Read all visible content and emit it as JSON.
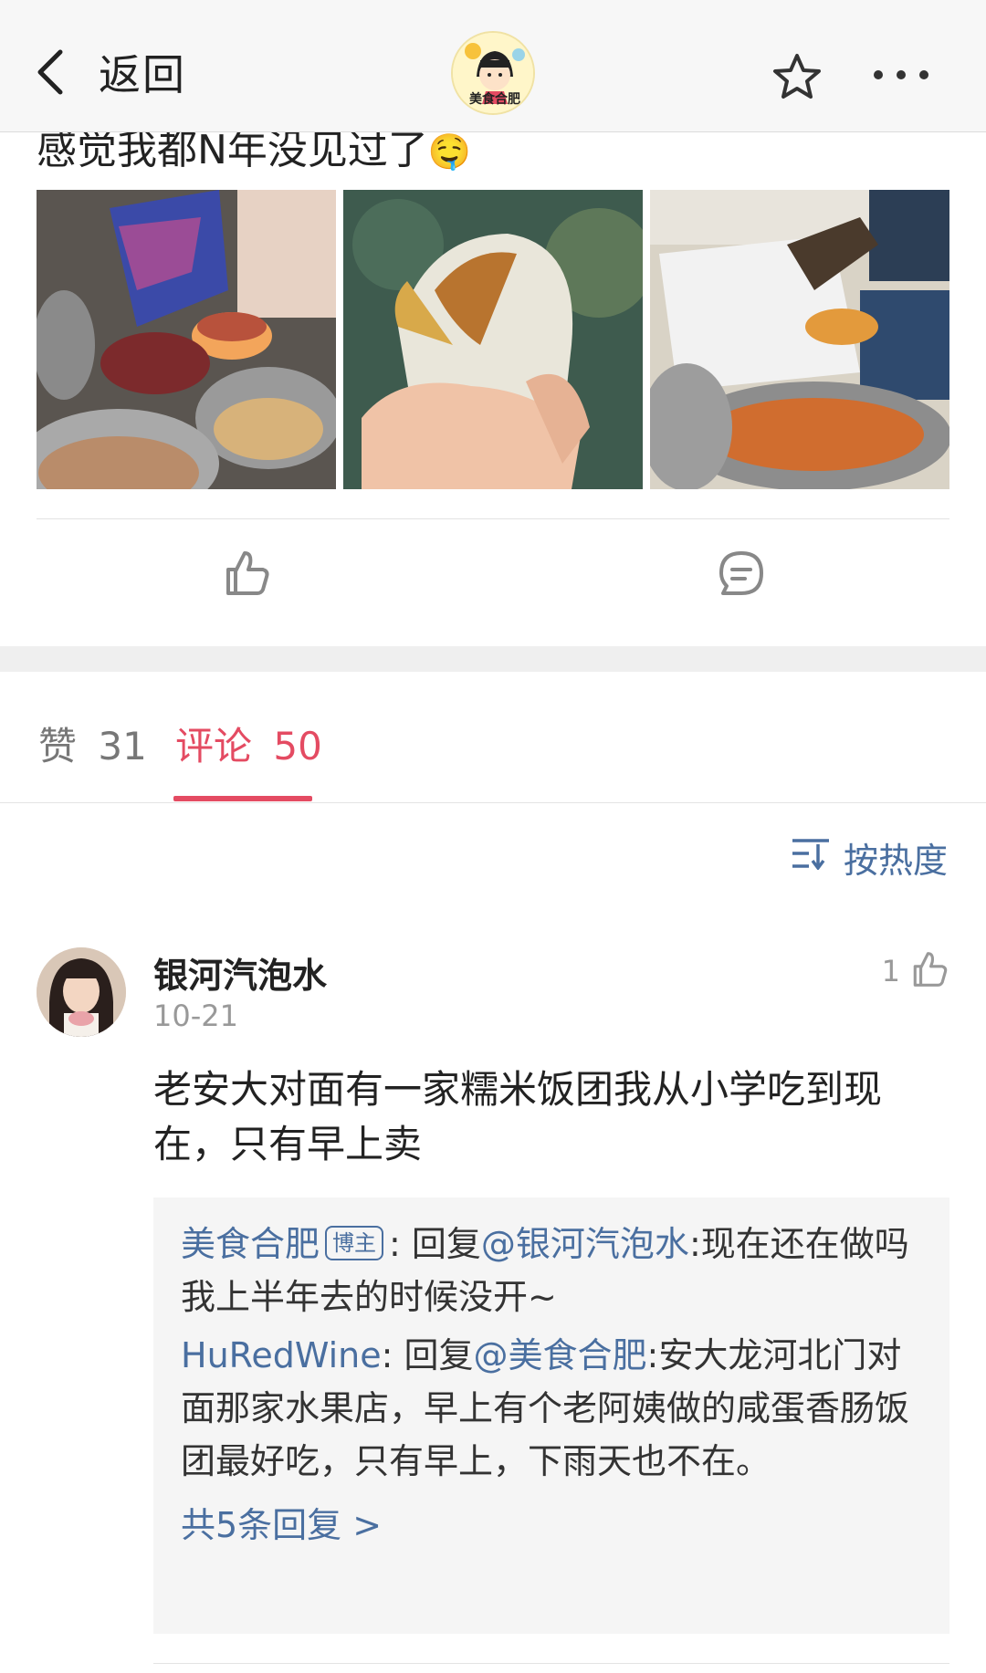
{
  "header": {
    "back_label": "返回",
    "avatar_text": "美食合肥"
  },
  "post": {
    "text": "感觉我都N年没见过了",
    "emoji": "🤤",
    "images": [
      "rice-ball-making",
      "rice-ball-in-hand",
      "rice-ball-vendor"
    ]
  },
  "tabs": {
    "likes_label": "赞",
    "likes_count": "31",
    "comments_label": "评论",
    "comments_count": "50"
  },
  "sort": {
    "label": "按热度"
  },
  "comment": {
    "author": "银河汽泡水",
    "date": "10-21",
    "likes": "1",
    "text": "老安大对面有一家糯米饭团我从小学吃到现在，只有早上卖",
    "replies": [
      {
        "author": "美食合肥",
        "badge": "博主",
        "sep": ": ",
        "verb": "回复",
        "mention": "@银河汽泡水",
        "text": ":现在还在做吗 我上半年去的时候没开~"
      },
      {
        "author": "HuRedWine",
        "sep": ": ",
        "verb": "回复",
        "mention": "@美食合肥",
        "text": ":安大龙河北门对面那家水果店，早上有个老阿姨做的咸蛋香肠饭团最好吃，只有早上，下雨天也不在。"
      }
    ],
    "more_replies": "共5条回复 >"
  },
  "colors": {
    "accent": "#e44b62",
    "link": "#4a6fa0"
  }
}
